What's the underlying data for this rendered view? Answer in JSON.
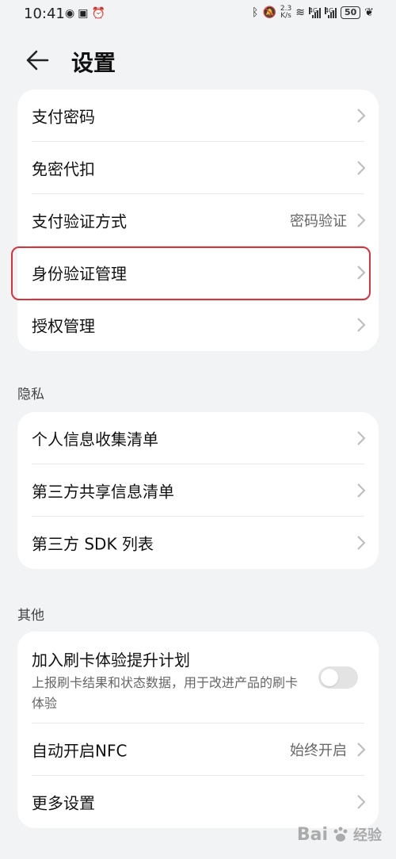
{
  "status_bar": {
    "time": "10:41",
    "speed_top": "2.3",
    "speed_bottom": "K/s",
    "battery": "50",
    "sig1_label": "4G",
    "sig2_label": "4G"
  },
  "header": {
    "title": "设置"
  },
  "payment_card": {
    "items": [
      {
        "label": "支付密码",
        "value": ""
      },
      {
        "label": "免密代扣",
        "value": ""
      },
      {
        "label": "支付验证方式",
        "value": "密码验证"
      },
      {
        "label": "身份验证管理",
        "value": ""
      },
      {
        "label": "授权管理",
        "value": ""
      }
    ]
  },
  "privacy": {
    "title": "隐私",
    "items": [
      {
        "label": "个人信息收集清单"
      },
      {
        "label": "第三方共享信息清单"
      },
      {
        "label": "第三方 SDK 列表"
      }
    ]
  },
  "other": {
    "title": "其他",
    "card_join": {
      "label": "加入刷卡体验提升计划",
      "sub": "上报刷卡结果和状态数据，用于改进产品的刷卡体验",
      "toggle_on": false
    },
    "items": [
      {
        "label": "自动开启NFC",
        "value": "始终开启"
      },
      {
        "label": "更多设置",
        "value": ""
      }
    ]
  },
  "watermark": {
    "text": "Bai",
    "text2": "经验"
  }
}
